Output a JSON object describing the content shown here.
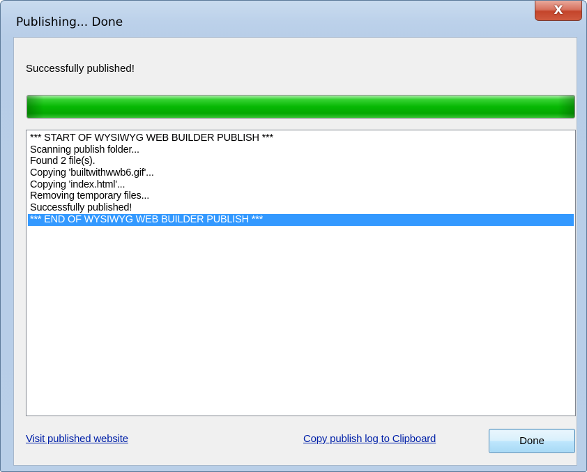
{
  "window": {
    "title": "Publishing... Done",
    "close_label": "X"
  },
  "status": {
    "message": "Successfully published!",
    "progress_percent": 100,
    "progress_color": "#07b804"
  },
  "log": {
    "lines": [
      "*** START OF WYSIWYG WEB BUILDER PUBLISH ***",
      "Scanning publish folder...",
      "Found 2 file(s).",
      "Copying 'builtwithwwb6.gif'...",
      "Copying 'index.html'...",
      "Removing temporary files...",
      "Successfully published!",
      "*** END OF WYSIWYG WEB BUILDER PUBLISH ***"
    ],
    "selected_index": 7,
    "selection_color": "#3399ff"
  },
  "footer": {
    "visit_link": "Visit published website",
    "copy_link": "Copy publish log to Clipboard",
    "done_button": "Done"
  }
}
